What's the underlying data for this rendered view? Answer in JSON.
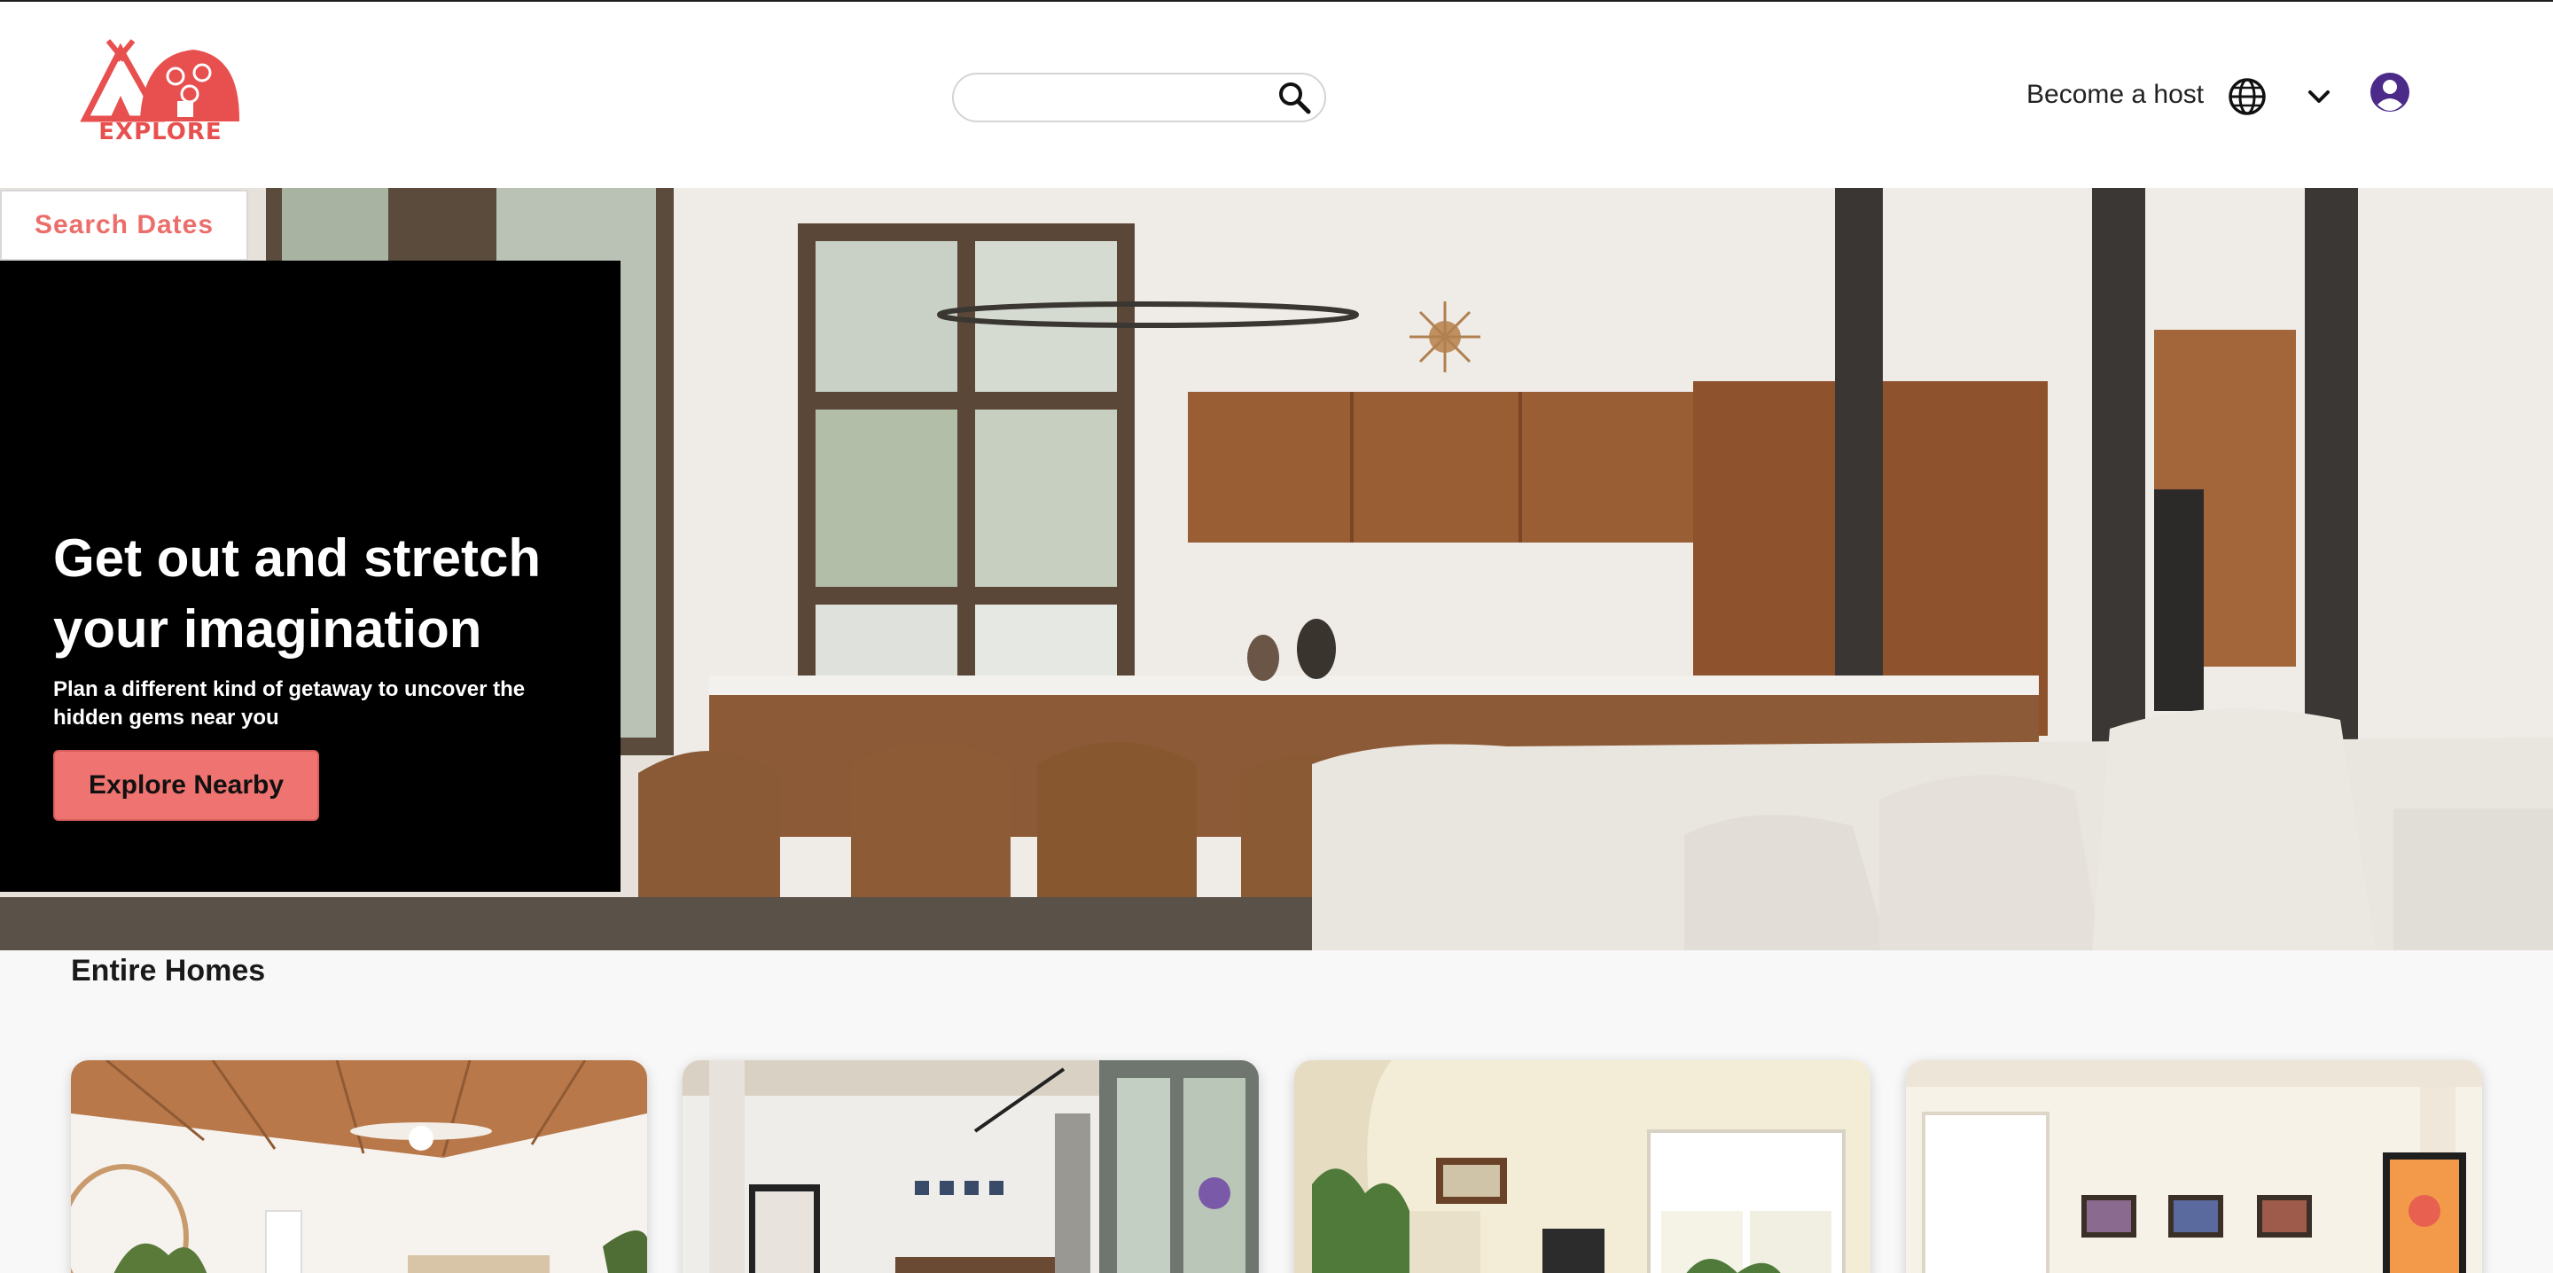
{
  "header": {
    "logo_text": "EXPLORE",
    "search": {
      "placeholder": ""
    },
    "become_host_label": "Become a host"
  },
  "hero": {
    "search_dates_label": "Search Dates",
    "title": "Get out and stretch your imagination",
    "subtitle": "Plan a different kind of getaway to uncover the hidden gems near you",
    "cta_label": "Explore Nearby"
  },
  "listings": {
    "section_title": "Entire Homes",
    "cards": [
      {
        "photo": "bedroom-wood-ceiling"
      },
      {
        "photo": "loft-living-room"
      },
      {
        "photo": "arched-window-living-room"
      },
      {
        "photo": "white-room-framed-art"
      }
    ]
  },
  "colors": {
    "brand": "#e8504f",
    "cta": "#ef7370",
    "user_icon": "#4b2a8a"
  },
  "icons": [
    "logo-icon",
    "search-icon",
    "globe-icon",
    "chevron-down-icon",
    "user-icon"
  ]
}
